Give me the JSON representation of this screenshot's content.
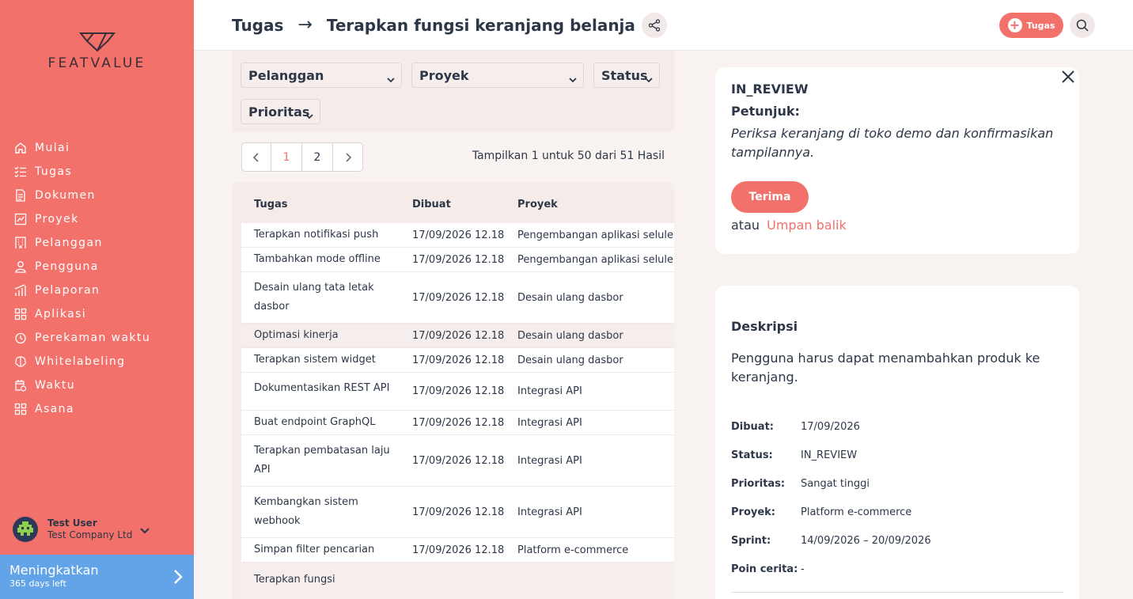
{
  "brand": {
    "wordmark": "FEATVALUE"
  },
  "nav": {
    "items": [
      {
        "label": "Mulai",
        "icon": "home-icon"
      },
      {
        "label": "Tugas",
        "icon": "checklist-icon"
      },
      {
        "label": "Dokumen",
        "icon": "document-icon"
      },
      {
        "label": "Proyek",
        "icon": "chart-icon"
      },
      {
        "label": "Pelanggan",
        "icon": "building-icon"
      },
      {
        "label": "Pengguna",
        "icon": "user-icon"
      },
      {
        "label": "Pelaporan",
        "icon": "bar-chart-icon"
      },
      {
        "label": "Aplikasi",
        "icon": "grid-icon"
      },
      {
        "label": "Perekaman waktu",
        "icon": "stopwatch-icon"
      },
      {
        "label": "Whitelabeling",
        "icon": "brain-icon"
      },
      {
        "label": "Waktu",
        "icon": "calendar-clock-icon"
      },
      {
        "label": "Asana",
        "icon": "grid-icon"
      }
    ]
  },
  "user": {
    "name": "Test User",
    "company": "Test Company Ltd"
  },
  "upgrade": {
    "title": "Meningkatkan",
    "subtitle": "365 days left"
  },
  "header": {
    "breadcrumb_root": "Tugas",
    "breadcrumb_arrow": "→",
    "breadcrumb_current": "Terapkan fungsi keranjang belanja",
    "add_label": "Tugas"
  },
  "filters": {
    "customer": "Pelanggan",
    "project": "Proyek",
    "status": "Status",
    "priority": "Prioritas"
  },
  "pagination": {
    "pages": [
      "1",
      "2"
    ],
    "current": "1",
    "summary": "Tampilkan 1 untuk 50 dari 51 Hasil"
  },
  "table": {
    "headers": [
      "Tugas",
      "Dibuat",
      "Proyek"
    ],
    "rows": [
      {
        "task": "Terapkan notifikasi push",
        "created": "17/09/2026 12.18",
        "project": "Pengembangan aplikasi seluler"
      },
      {
        "task": "Tambahkan mode offline",
        "created": "17/09/2026 12.18",
        "project": "Pengembangan aplikasi seluler"
      },
      {
        "task": "Desain ulang tata letak dasbor",
        "created": "17/09/2026 12.18",
        "project": "Desain ulang dasbor"
      },
      {
        "task": "Optimasi kinerja",
        "created": "17/09/2026 12.18",
        "project": "Desain ulang dasbor"
      },
      {
        "task": "Terapkan sistem widget",
        "created": "17/09/2026 12.18",
        "project": "Desain ulang dasbor"
      },
      {
        "task": "Dokumentasikan REST API",
        "created": "17/09/2026 12.18",
        "project": "Integrasi API"
      },
      {
        "task": "Buat endpoint GraphQL",
        "created": "17/09/2026 12.18",
        "project": "Integrasi API"
      },
      {
        "task": "Terapkan pembatasan laju API",
        "created": "17/09/2026 12.18",
        "project": "Integrasi API"
      },
      {
        "task": "Kembangkan sistem webhook",
        "created": "17/09/2026 12.18",
        "project": "Integrasi API"
      },
      {
        "task": "Simpan filter pencarian",
        "created": "17/09/2026 12.18",
        "project": "Platform e-commerce"
      },
      {
        "task": "Terapkan fungsi",
        "created": "",
        "project": ""
      }
    ]
  },
  "review": {
    "status": "IN_REVIEW",
    "hint_label": "Petunjuk:",
    "hint_text": "Periksa keranjang di toko demo dan konfirmasikan tampilannya.",
    "accept_label": "Terima",
    "or_label": "atau",
    "feedback_label": "Umpan balik"
  },
  "details": {
    "title": "Deskripsi",
    "description": "Pengguna harus dapat menambahkan produk ke keranjang.",
    "fields": [
      {
        "key": "Dibuat:",
        "value": "17/09/2026"
      },
      {
        "key": "Status:",
        "value": "IN_REVIEW"
      },
      {
        "key": "Prioritas:",
        "value": "Sangat tinggi"
      },
      {
        "key": "Proyek:",
        "value": "Platform e-commerce"
      },
      {
        "key": "Sprint:",
        "value": "14/09/2026 – 20/09/2026"
      },
      {
        "key": "Poin cerita:",
        "value": "-"
      }
    ]
  },
  "colors": {
    "accent": "#f2716b",
    "upgrade": "#63a4e9",
    "text": "#2d3748"
  }
}
